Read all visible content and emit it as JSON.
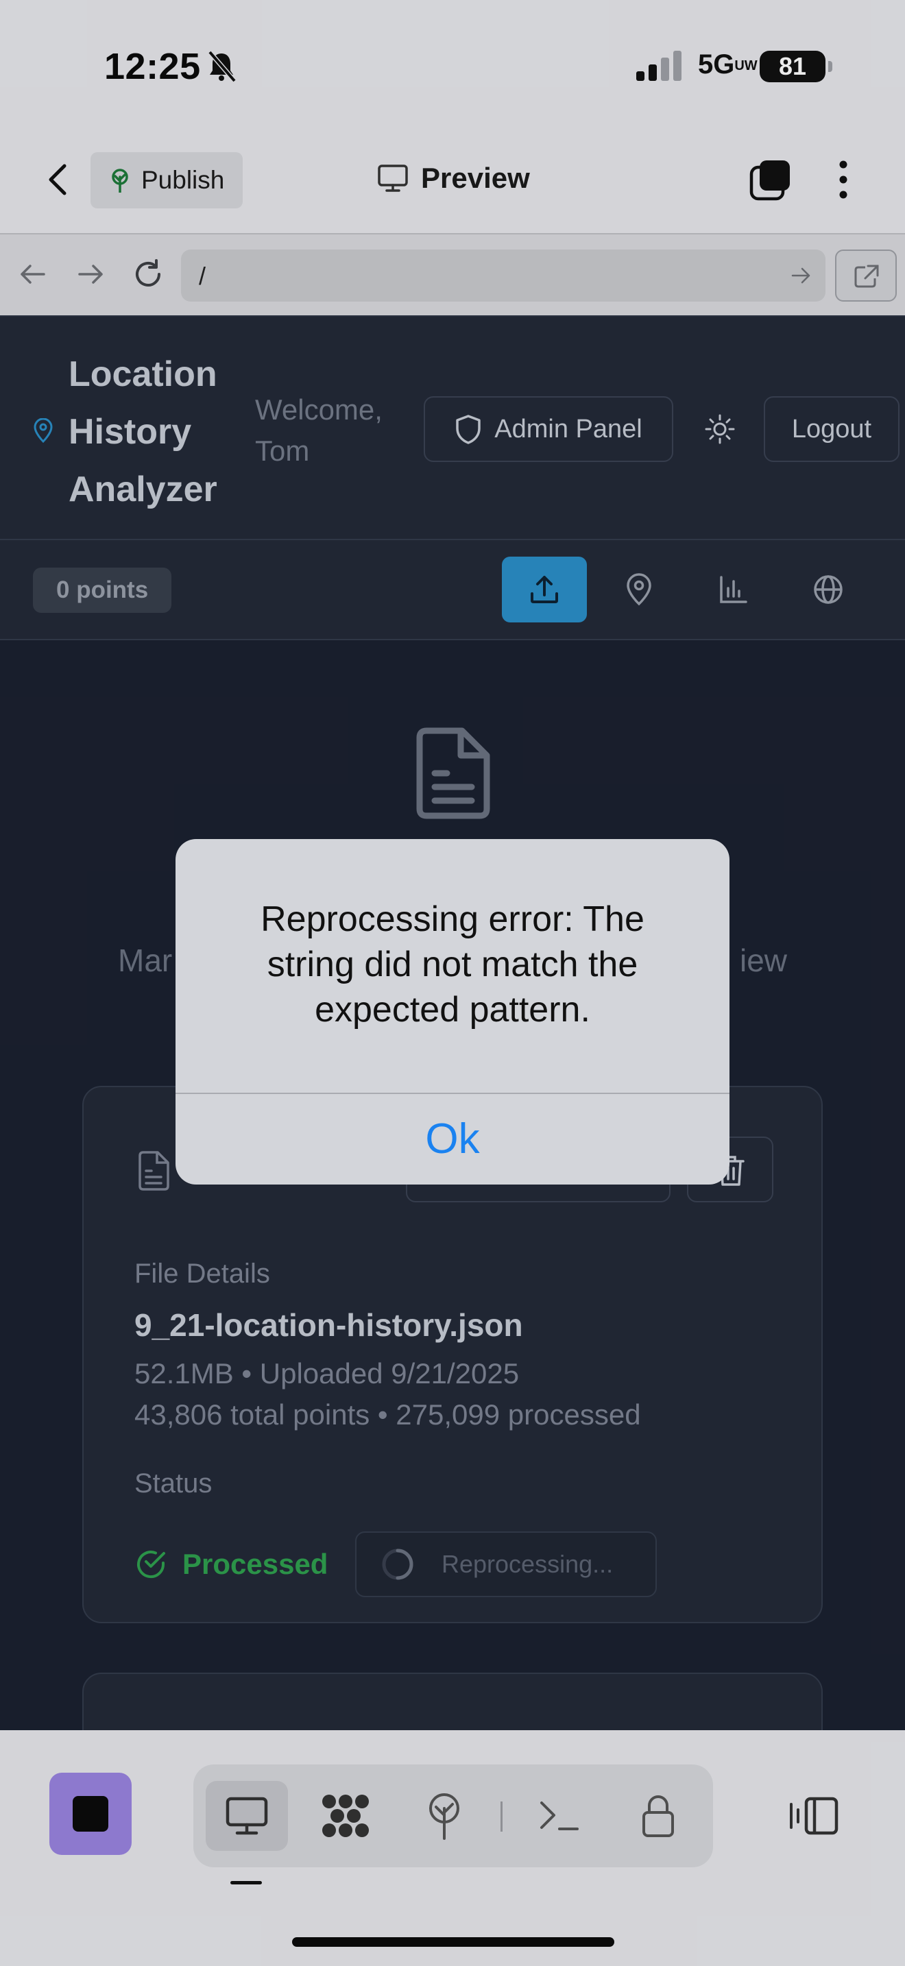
{
  "status_bar": {
    "time": "12:25",
    "network": "5G",
    "network_suffix": "UW",
    "battery": "81"
  },
  "top_bar": {
    "publish_label": "Publish",
    "preview_label": "Preview"
  },
  "browser": {
    "url": "/"
  },
  "header": {
    "title": "Location History Analyzer",
    "welcome": "Welcome, Tom",
    "admin_label": "Admin Panel",
    "logout_label": "Logout"
  },
  "toolbar": {
    "points_badge": "0 points"
  },
  "main": {
    "manage_left": "Mar",
    "manage_right": "iew"
  },
  "file_card": {
    "details_label": "File Details",
    "file_name": "9_21-location-history.json",
    "meta_line1": "52.1MB • Uploaded 9/21/2025",
    "meta_line2": "43,806 total points • 275,099 processed",
    "status_label": "Status",
    "status_value": "Processed",
    "reprocess_label": "Reprocessing..."
  },
  "dialog": {
    "message": "Reprocessing error: The string did not match the expected pattern.",
    "ok_label": "Ok"
  },
  "colors": {
    "accent_blue": "#2b8fc8",
    "success_green": "#2fa04f",
    "dialog_link": "#1a82f0",
    "stop_purple": "#9a84e0"
  }
}
